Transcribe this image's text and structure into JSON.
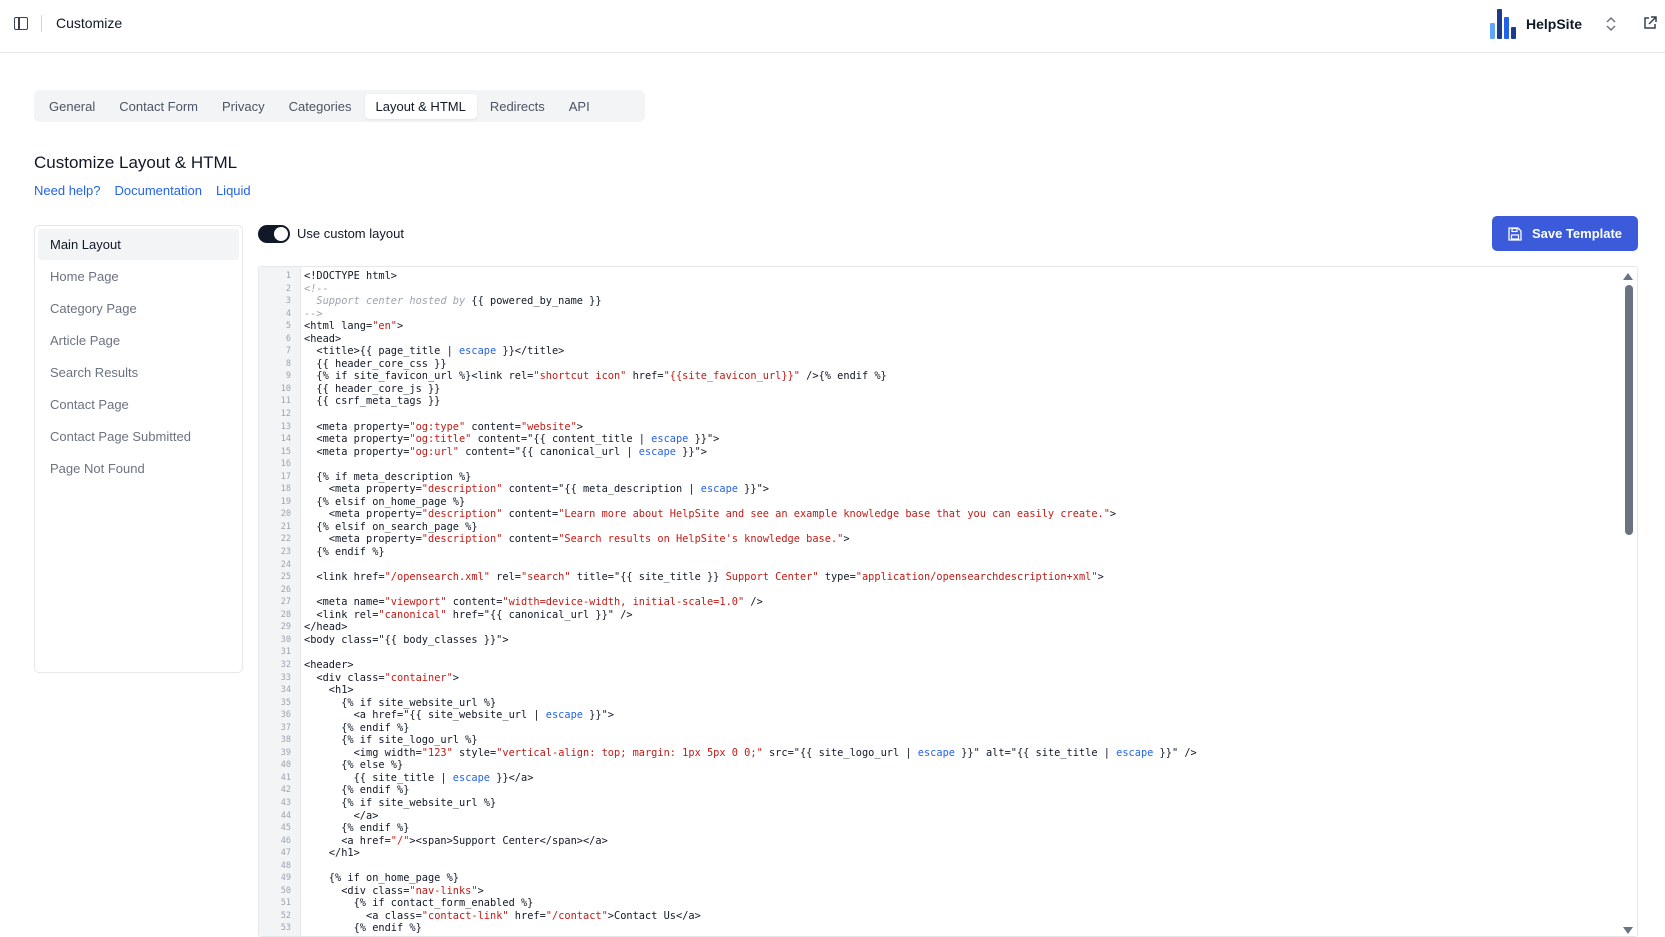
{
  "topbar": {
    "title": "Customize",
    "brand_name": "HelpSite",
    "brand_colors": [
      "#1e3a8a",
      "#2563eb",
      "#60a5fa"
    ]
  },
  "tabs": [
    {
      "label": "General",
      "active": false
    },
    {
      "label": "Contact Form",
      "active": false
    },
    {
      "label": "Privacy",
      "active": false
    },
    {
      "label": "Categories",
      "active": false
    },
    {
      "label": "Layout & HTML",
      "active": true
    },
    {
      "label": "Redirects",
      "active": false
    },
    {
      "label": "API",
      "active": false
    }
  ],
  "heading": "Customize Layout & HTML",
  "help_links": [
    "Need help?",
    "Documentation",
    "Liquid"
  ],
  "templates": [
    {
      "label": "Main Layout",
      "active": true
    },
    {
      "label": "Home Page",
      "active": false
    },
    {
      "label": "Category Page",
      "active": false
    },
    {
      "label": "Article Page",
      "active": false
    },
    {
      "label": "Search Results",
      "active": false
    },
    {
      "label": "Contact Page",
      "active": false
    },
    {
      "label": "Contact Page Submitted",
      "active": false
    },
    {
      "label": "Page Not Found",
      "active": false
    }
  ],
  "custom_layout": {
    "label": "Use custom layout",
    "enabled": true
  },
  "save_button": {
    "label": "Save Template",
    "color": "#3b5bdb"
  },
  "editor": {
    "colors": {
      "string": "#c41a16",
      "filter": "#2563eb",
      "comment": "#9ca3af",
      "plain": "#111827"
    },
    "lines": [
      [
        [
          "<!DOCTYPE html>",
          "p"
        ]
      ],
      [
        [
          "<!--",
          "c"
        ]
      ],
      [
        [
          "  Support center hosted by ",
          "c"
        ],
        [
          "{{ powered_by_name }}",
          "p"
        ]
      ],
      [
        [
          "-->",
          "c"
        ]
      ],
      [
        [
          "<html lang=",
          "p"
        ],
        [
          "\"en\"",
          "s"
        ],
        [
          ">",
          "p"
        ]
      ],
      [
        [
          "<head>",
          "p"
        ]
      ],
      [
        [
          "  <title>{{ page_title | ",
          "p"
        ],
        [
          "escape",
          "f"
        ],
        [
          " }}</title>",
          "p"
        ]
      ],
      [
        [
          "  {{ header_core_css }}",
          "p"
        ]
      ],
      [
        [
          "  {% if site_favicon_url %}<link rel=",
          "p"
        ],
        [
          "\"shortcut icon\"",
          "s"
        ],
        [
          " href=",
          "p"
        ],
        [
          "\"{{site_favicon_url}}\"",
          "s"
        ],
        [
          " />{% endif %}",
          "p"
        ]
      ],
      [
        [
          "  {{ header_core_js }}",
          "p"
        ]
      ],
      [
        [
          "  {{ csrf_meta_tags }}",
          "p"
        ]
      ],
      [
        [
          "",
          "p"
        ]
      ],
      [
        [
          "  <meta property=",
          "p"
        ],
        [
          "\"og:type\"",
          "s"
        ],
        [
          " content=",
          "p"
        ],
        [
          "\"website\"",
          "s"
        ],
        [
          ">",
          "p"
        ]
      ],
      [
        [
          "  <meta property=",
          "p"
        ],
        [
          "\"og:title\"",
          "s"
        ],
        [
          " content=\"{{ content_title | ",
          "p"
        ],
        [
          "escape",
          "f"
        ],
        [
          " }}\">",
          "p"
        ]
      ],
      [
        [
          "  <meta property=",
          "p"
        ],
        [
          "\"og:url\"",
          "s"
        ],
        [
          " content=\"{{ canonical_url | ",
          "p"
        ],
        [
          "escape",
          "f"
        ],
        [
          " }}\">",
          "p"
        ]
      ],
      [
        [
          "",
          "p"
        ]
      ],
      [
        [
          "  {% if meta_description %}",
          "p"
        ]
      ],
      [
        [
          "    <meta property=",
          "p"
        ],
        [
          "\"description\"",
          "s"
        ],
        [
          " content=\"{{ meta_description | ",
          "p"
        ],
        [
          "escape",
          "f"
        ],
        [
          " }}\">",
          "p"
        ]
      ],
      [
        [
          "  {% elsif on_home_page %}",
          "p"
        ]
      ],
      [
        [
          "    <meta property=",
          "p"
        ],
        [
          "\"description\"",
          "s"
        ],
        [
          " content=",
          "p"
        ],
        [
          "\"Learn more about HelpSite and see an example knowledge base that you can easily create.\"",
          "s"
        ],
        [
          ">",
          "p"
        ]
      ],
      [
        [
          "  {% elsif on_search_page %}",
          "p"
        ]
      ],
      [
        [
          "    <meta property=",
          "p"
        ],
        [
          "\"description\"",
          "s"
        ],
        [
          " content=",
          "p"
        ],
        [
          "\"Search results on HelpSite's knowledge base.\"",
          "s"
        ],
        [
          ">",
          "p"
        ]
      ],
      [
        [
          "  {% endif %}",
          "p"
        ]
      ],
      [
        [
          "",
          "p"
        ]
      ],
      [
        [
          "  <link href=",
          "p"
        ],
        [
          "\"/opensearch.xml\"",
          "s"
        ],
        [
          " rel=",
          "p"
        ],
        [
          "\"search\"",
          "s"
        ],
        [
          " title=\"{{ site_title }} ",
          "p"
        ],
        [
          "Support Center\"",
          "s"
        ],
        [
          " type=",
          "p"
        ],
        [
          "\"application/opensearchdescription+xml\"",
          "s"
        ],
        [
          ">",
          "p"
        ]
      ],
      [
        [
          "",
          "p"
        ]
      ],
      [
        [
          "  <meta name=",
          "p"
        ],
        [
          "\"viewport\"",
          "s"
        ],
        [
          " content=",
          "p"
        ],
        [
          "\"width=device-width, initial-scale=1.0\"",
          "s"
        ],
        [
          " />",
          "p"
        ]
      ],
      [
        [
          "  <link rel=",
          "p"
        ],
        [
          "\"canonical\"",
          "s"
        ],
        [
          " href=\"{{ canonical_url }}\" />",
          "p"
        ]
      ],
      [
        [
          "</head>",
          "p"
        ]
      ],
      [
        [
          "<body class=\"{{ body_classes }}\">",
          "p"
        ]
      ],
      [
        [
          "",
          "p"
        ]
      ],
      [
        [
          "<header>",
          "p"
        ]
      ],
      [
        [
          "  <div class=",
          "p"
        ],
        [
          "\"container\"",
          "s"
        ],
        [
          ">",
          "p"
        ]
      ],
      [
        [
          "    <h1>",
          "p"
        ]
      ],
      [
        [
          "      {% if site_website_url %}",
          "p"
        ]
      ],
      [
        [
          "        <a href=\"{{ site_website_url | ",
          "p"
        ],
        [
          "escape",
          "f"
        ],
        [
          " }}\">",
          "p"
        ]
      ],
      [
        [
          "      {% endif %}",
          "p"
        ]
      ],
      [
        [
          "      {% if site_logo_url %}",
          "p"
        ]
      ],
      [
        [
          "        <img width=",
          "p"
        ],
        [
          "\"123\"",
          "s"
        ],
        [
          " style=",
          "p"
        ],
        [
          "\"vertical-align: top; margin: 1px 5px 0 0;\"",
          "s"
        ],
        [
          " src=\"{{ site_logo_url | ",
          "p"
        ],
        [
          "escape",
          "f"
        ],
        [
          " }}\" alt=\"{{ site_title | ",
          "p"
        ],
        [
          "escape",
          "f"
        ],
        [
          " }}\" />",
          "p"
        ]
      ],
      [
        [
          "      {% else %}",
          "p"
        ]
      ],
      [
        [
          "        {{ site_title | ",
          "p"
        ],
        [
          "escape",
          "f"
        ],
        [
          " }}</a>",
          "p"
        ]
      ],
      [
        [
          "      {% endif %}",
          "p"
        ]
      ],
      [
        [
          "      {% if site_website_url %}",
          "p"
        ]
      ],
      [
        [
          "        </a>",
          "p"
        ]
      ],
      [
        [
          "      {% endif %}",
          "p"
        ]
      ],
      [
        [
          "      <a href=",
          "p"
        ],
        [
          "\"/\"",
          "s"
        ],
        [
          "><span>Support Center</span></a>",
          "p"
        ]
      ],
      [
        [
          "    </h1>",
          "p"
        ]
      ],
      [
        [
          "",
          "p"
        ]
      ],
      [
        [
          "    {% if on_home_page %}",
          "p"
        ]
      ],
      [
        [
          "      <div class=",
          "p"
        ],
        [
          "\"nav-links\"",
          "s"
        ],
        [
          ">",
          "p"
        ]
      ],
      [
        [
          "        {% if contact_form_enabled %}",
          "p"
        ]
      ],
      [
        [
          "          <a class=",
          "p"
        ],
        [
          "\"contact-link\"",
          "s"
        ],
        [
          " href=",
          "p"
        ],
        [
          "\"/contact\"",
          "s"
        ],
        [
          ">Contact Us</a>",
          "p"
        ]
      ],
      [
        [
          "        {% endif %}",
          "p"
        ]
      ]
    ]
  }
}
